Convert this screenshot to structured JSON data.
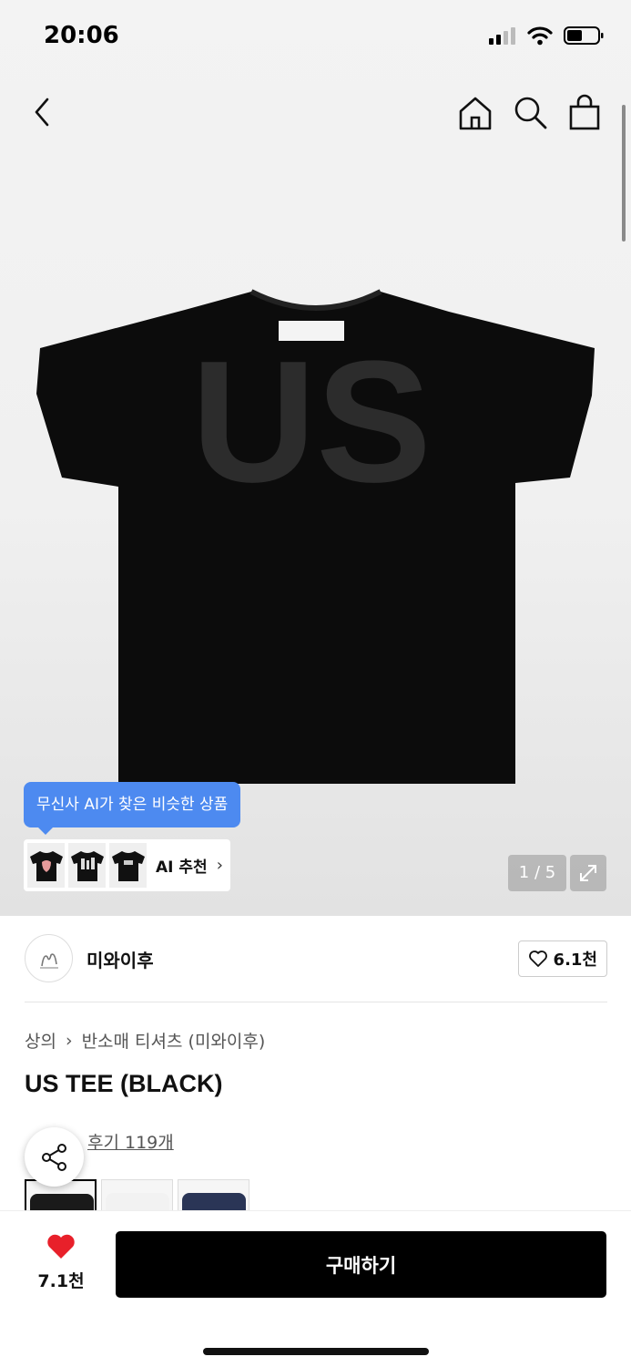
{
  "status": {
    "time": "20:06"
  },
  "icons": {
    "back": "chevron-left-icon",
    "home": "home-icon",
    "search": "search-icon",
    "bag": "shopping-bag-icon",
    "share": "share-icon",
    "heart": "heart-icon"
  },
  "product_image": {
    "print_text": "US"
  },
  "ai": {
    "tooltip": "무신사 AI가 찾은 비슷한 상품",
    "label": "AI 추천",
    "chevron": "›"
  },
  "pager": {
    "text": "1 / 5"
  },
  "brand": {
    "name": "미와이후",
    "like_count": "6.1천"
  },
  "breadcrumb": {
    "level1": "상의",
    "separator": "›",
    "level2": "반소매 티셔츠 (미와이후)"
  },
  "product": {
    "title": "US TEE (BLACK)",
    "reviews": "후기 119개"
  },
  "swatch_colors": [
    "#1a1a1a",
    "#f2f2f2",
    "#2a3556"
  ],
  "bottom": {
    "like_count": "7.1천",
    "buy_label": "구매하기"
  },
  "colors": {
    "accent_blue": "#4d8af0",
    "heart_red": "#e8202a",
    "buy_black": "#000000"
  }
}
